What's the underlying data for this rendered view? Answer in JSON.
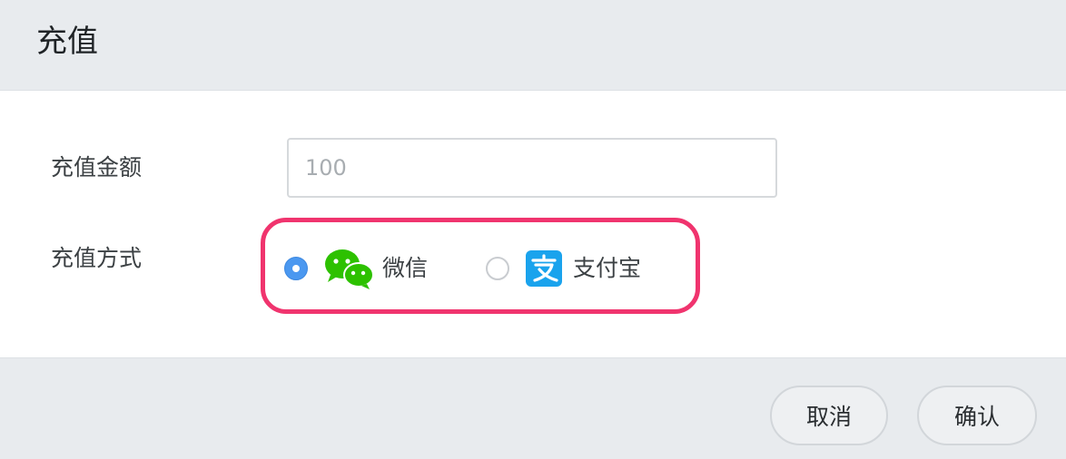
{
  "dialog": {
    "title": "充值"
  },
  "form": {
    "amount_label": "充值金额",
    "amount_placeholder": "100",
    "amount_value": "",
    "method_label": "充值方式",
    "payment_options": [
      {
        "label": "微信",
        "icon": "wechat-icon",
        "selected": true,
        "color": "#2dc100"
      },
      {
        "label": "支付宝",
        "icon": "alipay-icon",
        "selected": false,
        "color": "#1aa3ed"
      }
    ]
  },
  "footer": {
    "cancel_label": "取消",
    "confirm_label": "确认"
  },
  "colors": {
    "accent": "#4b98f0",
    "highlight": "#f0346e"
  }
}
